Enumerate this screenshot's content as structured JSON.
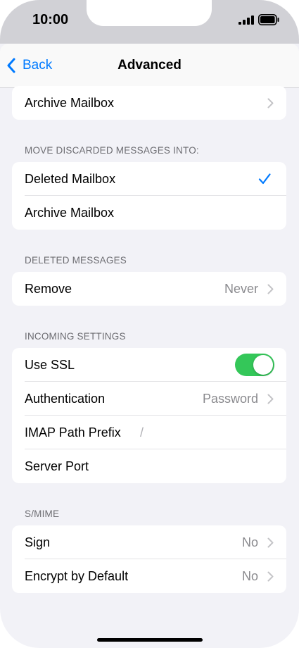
{
  "status_bar": {
    "time": "10:00"
  },
  "nav": {
    "back_label": "Back",
    "title": "Advanced"
  },
  "groups": {
    "archive": {
      "label": "Archive Mailbox"
    },
    "discarded": {
      "header": "MOVE DISCARDED MESSAGES INTO:",
      "items": [
        {
          "label": "Deleted Mailbox",
          "selected": true
        },
        {
          "label": "Archive Mailbox",
          "selected": false
        }
      ]
    },
    "deleted": {
      "header": "DELETED MESSAGES",
      "remove_label": "Remove",
      "remove_value": "Never"
    },
    "incoming": {
      "header": "INCOMING SETTINGS",
      "use_ssl_label": "Use SSL",
      "use_ssl_on": true,
      "auth_label": "Authentication",
      "auth_value": "Password",
      "imap_label": "IMAP Path Prefix",
      "imap_value": "/",
      "port_label": "Server Port"
    },
    "smime": {
      "header": "S/MIME",
      "sign_label": "Sign",
      "sign_value": "No",
      "encrypt_label": "Encrypt by Default",
      "encrypt_value": "No"
    }
  },
  "colors": {
    "accent": "#007aff",
    "toggle_on": "#34c759",
    "background": "#f2f2f7"
  }
}
